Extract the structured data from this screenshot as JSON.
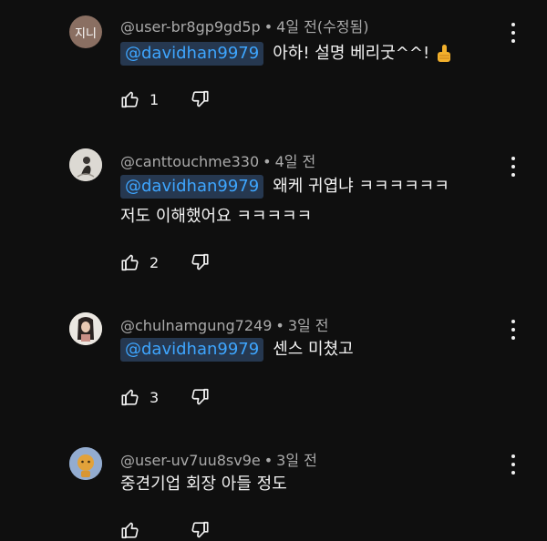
{
  "comments": [
    {
      "avatar_text": "지니",
      "author": "@user-br8gp9gd5p",
      "dot": "•",
      "time": "4일 전(수정됨)",
      "mention": "@davidhan9979",
      "text_lines": [
        "아하! 설명 베리굿^^!"
      ],
      "emoji": "thumbs-up",
      "likes": "1"
    },
    {
      "author": "@canttouchme330",
      "dot": "•",
      "time": "4일 전",
      "mention": "@davidhan9979",
      "text_lines": [
        "왜케 귀엽냐 ㅋㅋㅋㅋㅋㅋ",
        "저도 이해했어요 ㅋㅋㅋㅋㅋ"
      ],
      "likes": "2"
    },
    {
      "author": "@chulnamgung7249",
      "dot": "•",
      "time": "3일 전",
      "mention": "@davidhan9979",
      "text_lines": [
        "센스 미쳤고"
      ],
      "likes": "3"
    },
    {
      "author": "@user-uv7uu8sv9e",
      "dot": "•",
      "time": "3일 전",
      "text_lines": [
        "중견기업 회장 아들 정도"
      ],
      "likes": ""
    }
  ],
  "icons": {
    "like": "thumbs-up-outline-icon",
    "dislike": "thumbs-down-outline-icon",
    "more": "vertical-ellipsis-icon"
  },
  "colors": {
    "background": "#0f0f0f",
    "meta_text": "#aaaaaa",
    "mention_text": "#3ea6ff",
    "mention_bg": "#263850",
    "body_text": "#f1f1f1"
  }
}
